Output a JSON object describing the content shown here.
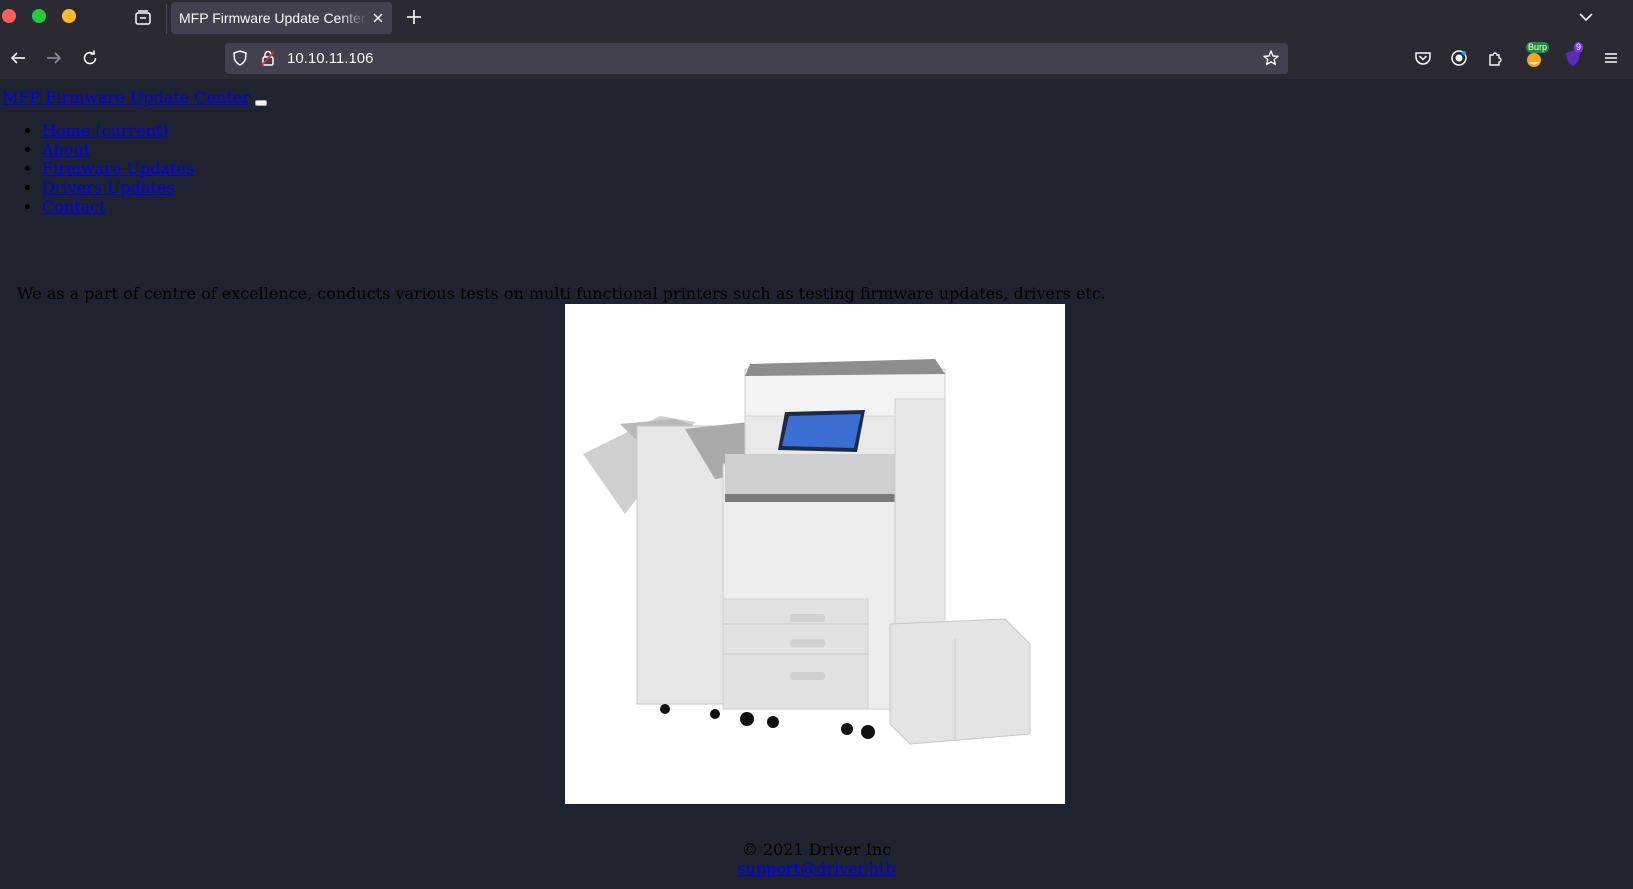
{
  "browser": {
    "tab_title": "MFP Firmware Update Center",
    "url": "10.10.11.106",
    "extensions": {
      "burp_badge": "Burp",
      "ublock_badge": "9"
    }
  },
  "page": {
    "brand": "MFP Firmware Update Center",
    "nav": [
      "Home (current)",
      "About",
      "Firmware Updates",
      "Drivers Updates",
      "Contact"
    ],
    "intro": "We as a part of centre of excellence, conducts various tests on multi functional printers such as testing firmware updates, drivers etc.",
    "copyright": "© 2021 Driver Inc",
    "support_link": "support@driver.htb"
  },
  "colors": {
    "page_bg": "#1f2330",
    "chrome_bg": "#2b2a33",
    "link": "#0000ee"
  }
}
